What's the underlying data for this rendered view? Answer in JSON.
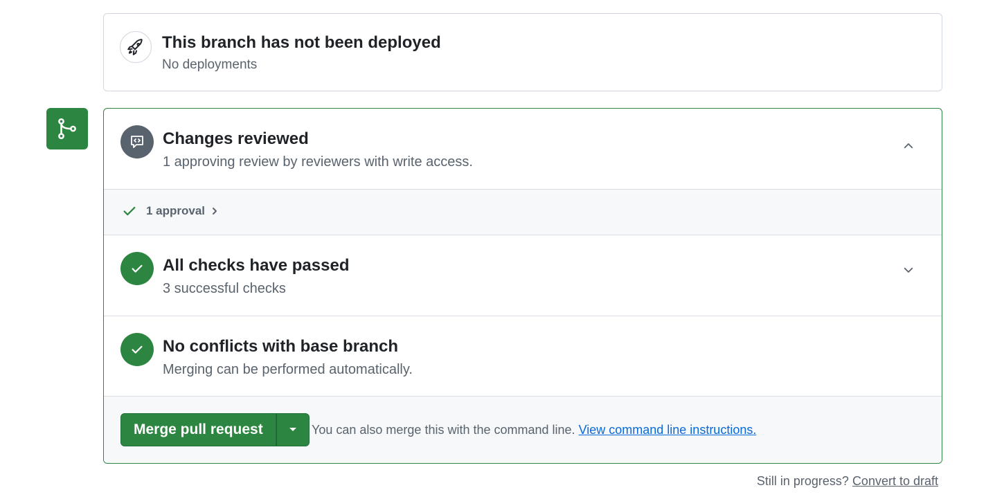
{
  "deployment": {
    "title": "This branch has not been deployed",
    "subtitle": "No deployments",
    "icon": "rocket-icon"
  },
  "merge_badge": {
    "icon": "git-merge-icon",
    "color": "#2c8540"
  },
  "review": {
    "title": "Changes reviewed",
    "subtitle": "1 approving review by reviewers with write access.",
    "icon": "code-review-icon",
    "expanded": true
  },
  "approval": {
    "label": "1 approval",
    "icon": "check-icon"
  },
  "checks": {
    "title": "All checks have passed",
    "subtitle": "3 successful checks",
    "icon": "check-circle-icon",
    "expanded": false
  },
  "conflicts": {
    "title": "No conflicts with base branch",
    "subtitle": "Merging can be performed automatically.",
    "icon": "check-circle-icon"
  },
  "merge": {
    "button_label": "Merge pull request",
    "hint_text": "You can also merge this with the command line.",
    "hint_link": "View command line instructions."
  },
  "draft": {
    "text": "Still in progress?",
    "link": "Convert to draft"
  },
  "colors": {
    "success": "#2c8540",
    "muted": "#59636e",
    "link": "#0969da",
    "border": "#d0d7de"
  }
}
